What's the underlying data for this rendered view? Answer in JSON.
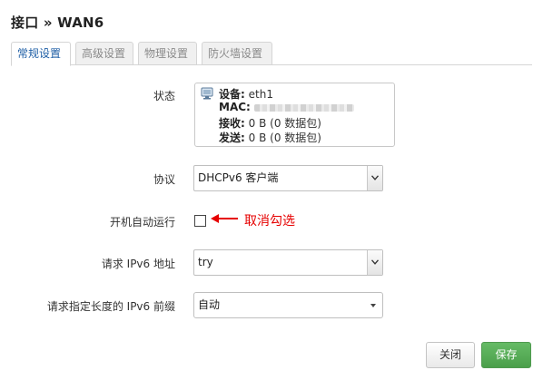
{
  "header": {
    "title": "接口 » WAN6"
  },
  "tabs": [
    {
      "label": "常规设置",
      "active": true
    },
    {
      "label": "高级设置",
      "active": false
    },
    {
      "label": "物理设置",
      "active": false
    },
    {
      "label": "防火墙设置",
      "active": false
    }
  ],
  "form": {
    "status": {
      "label": "状态",
      "device_key": "设备:",
      "device_value": "eth1",
      "mac_key": "MAC:",
      "rx_key": "接收:",
      "rx_value": "0 B (0 数据包)",
      "tx_key": "发送:",
      "tx_value": "0 B (0 数据包)"
    },
    "protocol": {
      "label": "协议",
      "value": "DHCPv6 客户端"
    },
    "autostart": {
      "label": "开机自动运行",
      "checked": false,
      "annotation": "取消勾选",
      "annotation_color": "#e60000"
    },
    "reqaddress": {
      "label": "请求 IPv6 地址",
      "value": "try"
    },
    "reqprefix": {
      "label": "请求指定长度的 IPv6 前缀",
      "value": "自动"
    }
  },
  "footer": {
    "close_label": "关闭",
    "save_label": "保存"
  },
  "colors": {
    "save_button": "#55aa55",
    "active_tab_text": "#1f5fa6"
  }
}
